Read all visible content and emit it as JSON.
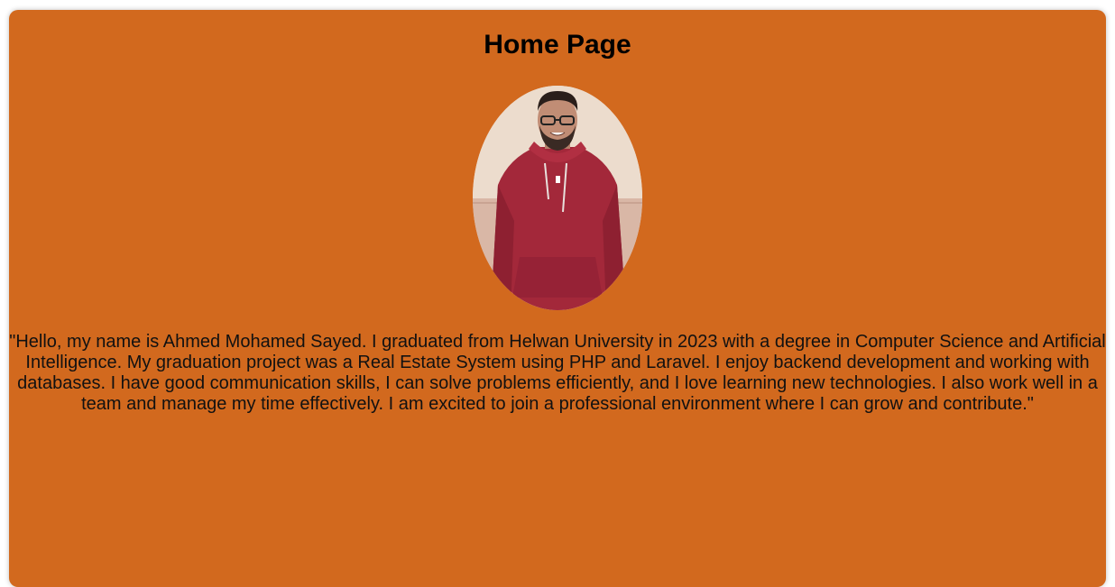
{
  "theme": {
    "page_background": "#ffffff",
    "card_background": "#d2691e",
    "text_color": "#000000"
  },
  "header": {
    "title": "Home Page"
  },
  "profile": {
    "photo_icon": "profile-photo",
    "bio": "\"Hello, my name is Ahmed Mohamed Sayed. I graduated from Helwan University in 2023 with a degree in Computer Science and Artificial Intelligence. My graduation project was a Real Estate System using PHP and Laravel. I enjoy backend development and working with databases. I have good communication skills, I can solve problems efficiently, and I love learning new technologies. I also work well in a team and manage my time effectively. I am excited to join a professional environment where I can grow and contribute.\""
  }
}
